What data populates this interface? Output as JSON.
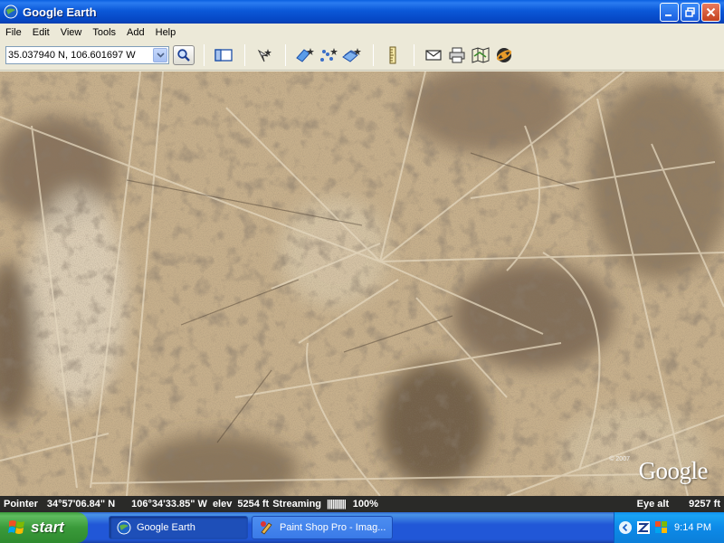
{
  "window": {
    "title": "Google Earth"
  },
  "menu": [
    "File",
    "Edit",
    "View",
    "Tools",
    "Add",
    "Help"
  ],
  "toolbar": {
    "coordinates_value": "35.037940 N, 106.601697 W",
    "icons": [
      "sidebar-icon",
      "placemark-icon",
      "polygon-icon",
      "path-icon",
      "image-overlay-icon",
      "ruler-icon",
      "email-icon",
      "print-icon",
      "google-maps-icon",
      "sky-icon"
    ]
  },
  "map": {
    "logo": "Google",
    "copyright": "© 2007"
  },
  "status": {
    "pointer_label": "Pointer",
    "lat": "34°57'06.84\" N",
    "lon": "106°34'33.85\" W",
    "elev_label": "elev",
    "elev_value": "5254 ft",
    "streaming_label": "Streaming",
    "streaming_bar": "||||||||||",
    "streaming_pct": "100%",
    "eye_label": "Eye alt",
    "eye_value": "9257 ft"
  },
  "taskbar": {
    "start_label": "start",
    "tasks": [
      {
        "label": "Google Earth",
        "active": true
      },
      {
        "label": "Paint Shop Pro - Imag...",
        "active": false
      }
    ],
    "clock": "9:14 PM"
  },
  "colors": {
    "titlebar_blue": "#0b58d8",
    "taskbar_blue": "#2157d7",
    "start_green": "#3a9a3a",
    "statusbar_bg": "#2a2a28",
    "terrain_base": "#c4ad8a"
  }
}
